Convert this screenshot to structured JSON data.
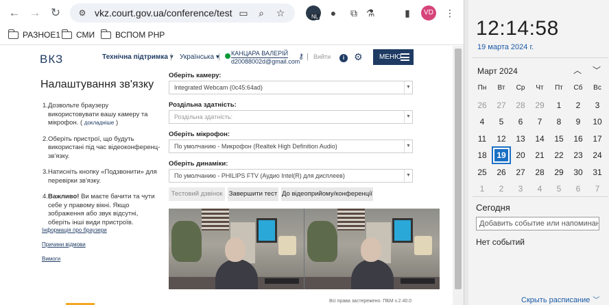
{
  "browser": {
    "url": "vkz.court.gov.ua/conference/test",
    "nl_badge": "NL",
    "profile_initials": "VD",
    "bookmarks": [
      "РАЗНОЕ1",
      "СМИ",
      "ВСПОМ РНР"
    ]
  },
  "site": {
    "logo": "ВКЗ",
    "nav": {
      "support": "Технічна підтримка ▾",
      "language": "Українська ▾",
      "user_name": "КАНЦАРА ВАЛЕРІЙ",
      "user_email": "d20088002d@gmail.com",
      "logout": "Вийти",
      "menu": "МЕНЮ"
    },
    "title": "Налаштування зв'язку",
    "steps": [
      {
        "num": "1.",
        "text": "Дозвольте браузеру використовувати вашу камеру та мікрофон. ( ",
        "link": "докладніше",
        "after": " )"
      },
      {
        "num": "2.",
        "text": "Оберіть пристрої, що будуть використані під час відеоконференц-зв'язку."
      },
      {
        "num": "3.",
        "text": "Натисніть кнопку «Подзвонити» для перевірки зв'язку."
      },
      {
        "num": "4.",
        "bold": "Важливо!",
        "text": " Ви маєте бачити та чути себе у правому вікні. Якщо зображення або звук відсутні, оберіть інші види пристроїв."
      }
    ],
    "side_links": [
      "Інформація про браузери",
      "Причини відмови",
      "Вимоги"
    ],
    "fields": {
      "camera_label": "Оберіть камеру:",
      "camera_value": "Integrated Webcam (0c45:64ad)",
      "resolution_label": "Роздільна здатність:",
      "resolution_placeholder": "Роздільна здатність:",
      "mic_label": "Оберіть мікрофон:",
      "mic_value": "По умолчанию - Микрофон (Realtek High Definition Audio)",
      "speaker_label": "Оберіть динаміки:",
      "speaker_value": "По умолчанию - PHILIPS FTV (Аудио Intel(R) для дисплеев)"
    },
    "buttons": {
      "test_call": "Тестовий дзвінок",
      "finish_test": "Завершити тест",
      "to_reception": "До відеоприйому/конференції"
    },
    "footer": "Всі права застережено. ПБМ v.2.40.0"
  },
  "calendar": {
    "time": "12:14:58",
    "date": "19 марта 2024 г.",
    "month": "Март 2024",
    "weekdays": [
      "Пн",
      "Вт",
      "Ср",
      "Чт",
      "Пт",
      "Сб",
      "Вс"
    ],
    "weeks": [
      [
        "26",
        "27",
        "28",
        "29",
        "1",
        "2",
        "3"
      ],
      [
        "4",
        "5",
        "6",
        "7",
        "8",
        "9",
        "10"
      ],
      [
        "11",
        "12",
        "13",
        "14",
        "15",
        "16",
        "17"
      ],
      [
        "18",
        "19",
        "20",
        "21",
        "22",
        "23",
        "24"
      ],
      [
        "25",
        "26",
        "27",
        "28",
        "29",
        "30",
        "31"
      ],
      [
        "1",
        "2",
        "3",
        "4",
        "5",
        "6",
        "7"
      ]
    ],
    "dim_cells": [
      [
        0,
        0
      ],
      [
        0,
        1
      ],
      [
        0,
        2
      ],
      [
        0,
        3
      ],
      [
        5,
        0
      ],
      [
        5,
        1
      ],
      [
        5,
        2
      ],
      [
        5,
        3
      ],
      [
        5,
        4
      ],
      [
        5,
        5
      ],
      [
        5,
        6
      ]
    ],
    "today_cell": [
      3,
      1
    ],
    "today_title": "Сегодня",
    "event_placeholder": "Добавить событие или напоминание",
    "no_events": "Нет событий",
    "hide_schedule": "Скрыть расписание"
  }
}
